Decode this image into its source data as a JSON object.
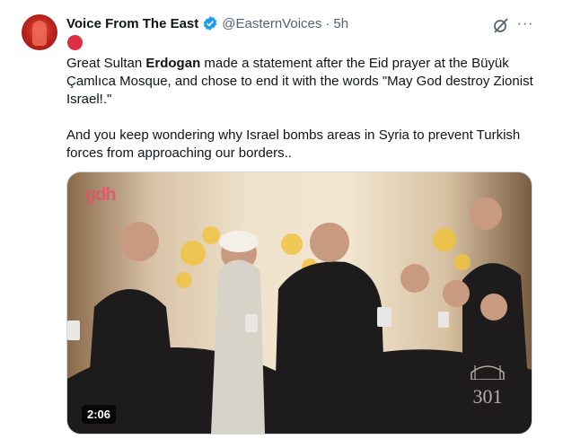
{
  "tweet": {
    "author_name": "Voice From The East",
    "handle": "@EasternVoices",
    "separator": "·",
    "time": "5h",
    "more_glyph": "···",
    "paragraph1": {
      "pre": "Great Sultan ",
      "bold": "Erdogan",
      "post": " made a statement after the Eid prayer at the Büyük Çamlıca Mosque, and chose to end it with the words \"May God destroy Zionist Israel!.\""
    },
    "paragraph2": "And you keep wondering why Israel bombs areas in Syria to prevent Turkish forces from approaching our borders..",
    "video": {
      "duration": "2:06",
      "watermark_left": "gdh",
      "watermark_right": "301"
    }
  },
  "colors": {
    "verified": "#1d9bf0",
    "secondary_text": "#536471",
    "border": "#cfd9de",
    "red_circle": "#dd2e44"
  }
}
